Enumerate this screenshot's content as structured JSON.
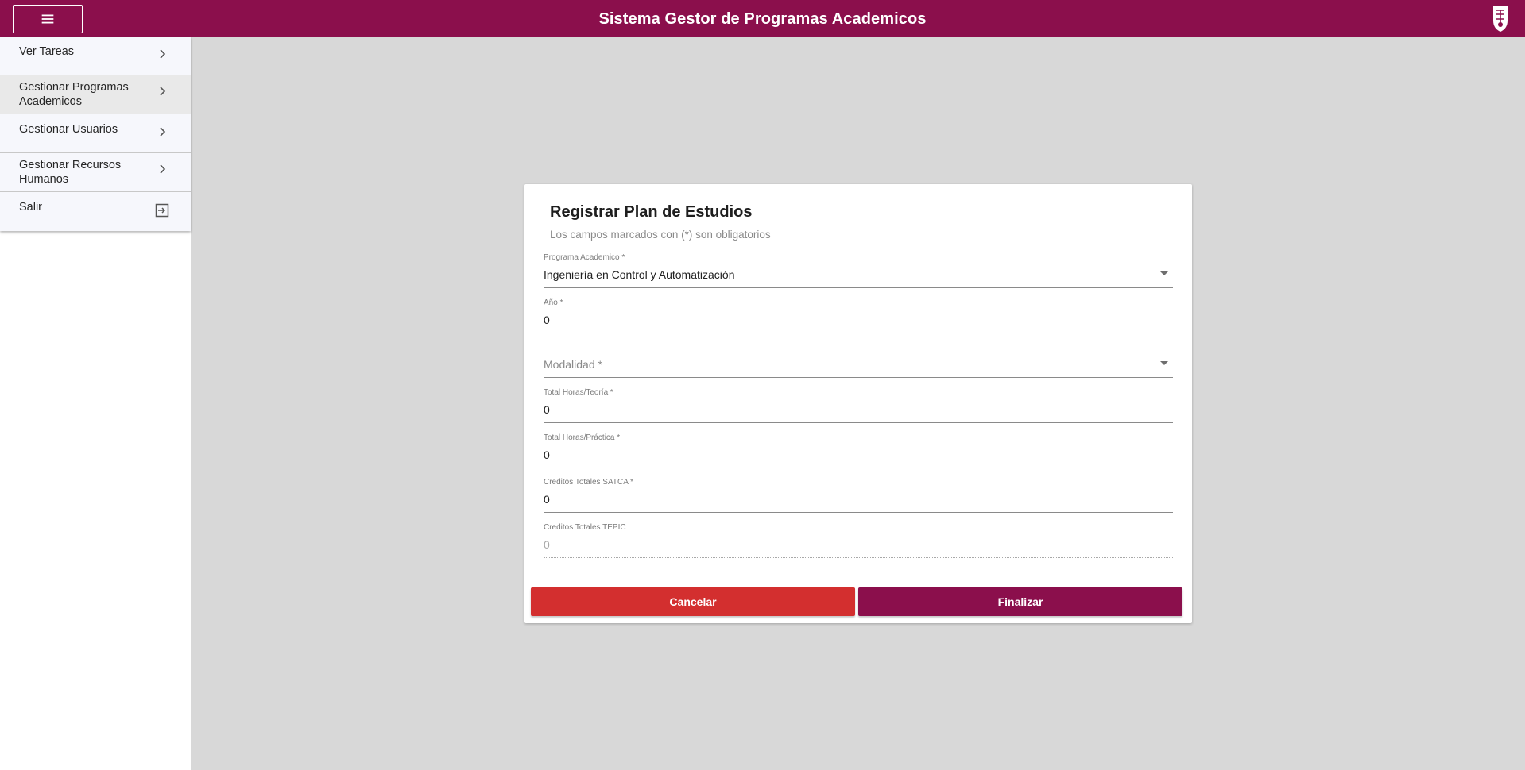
{
  "header": {
    "title": "Sistema Gestor de Programas Academicos",
    "menu_icon": "hamburger-menu-icon",
    "logo_icon": "institution-logo-icon",
    "brand_color": "#8b0f4c"
  },
  "sidebar": {
    "items": [
      {
        "label": "Ver Tareas",
        "icon": "chevron-right-icon"
      },
      {
        "label": "Gestionar Programas Academicos",
        "icon": "chevron-right-icon"
      },
      {
        "label": "Gestionar Usuarios",
        "icon": "chevron-right-icon"
      },
      {
        "label": "Gestionar Recursos Humanos",
        "icon": "chevron-right-icon"
      },
      {
        "label": "Salir",
        "icon": "exit-icon"
      }
    ]
  },
  "form": {
    "title": "Registrar Plan de Estudios",
    "subtitle": "Los campos marcados con (*) son obligatorios",
    "fields": {
      "programa": {
        "label": "Programa Academico *",
        "value": "Ingeniería en Control y Automatización"
      },
      "anio": {
        "label": "Año *",
        "value": "0"
      },
      "modalidad": {
        "placeholder": "Modalidad *",
        "value": ""
      },
      "horas_teoria": {
        "label": "Total Horas/Teoría *",
        "value": "0"
      },
      "horas_practica": {
        "label": "Total Horas/Práctica *",
        "value": "0"
      },
      "creditos_satca": {
        "label": "Creditos Totales SATCA *",
        "value": "0"
      },
      "creditos_tepic": {
        "label": "Creditos Totales TEPIC",
        "value": "0"
      }
    },
    "buttons": {
      "cancel": "Cancelar",
      "finish": "Finalizar"
    },
    "colors": {
      "cancel": "#d32f2f",
      "finish": "#8b0f4c"
    }
  }
}
